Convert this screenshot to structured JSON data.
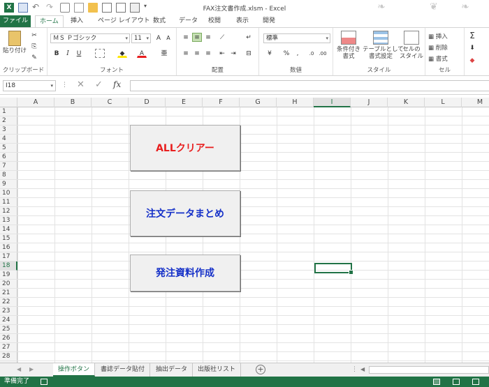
{
  "window": {
    "title": "FAX注文書作成.xlsm - Excel"
  },
  "ribbon_tabs": [
    "ファイル",
    "ホーム",
    "挿入",
    "ページ レイアウト",
    "数式",
    "データ",
    "校閲",
    "表示",
    "開発"
  ],
  "clipboard": {
    "paste_label": "貼り付け",
    "group_label": "クリップボード"
  },
  "font": {
    "name": "ＭＳ Ｐゴシック",
    "size": "11",
    "group_label": "フォント",
    "bold": "B",
    "italic": "I",
    "underline": "U"
  },
  "alignment": {
    "group_label": "配置"
  },
  "number": {
    "format": "標準",
    "group_label": "数値",
    "percent": "%",
    "comma": ","
  },
  "styles": {
    "conditional": "条件付き\n書式",
    "table": "テーブルとして\n書式設定",
    "cell_style": "セルの\nスタイル",
    "group_label": "スタイル"
  },
  "cells": {
    "insert": "挿入",
    "delete": "削除",
    "format": "書式",
    "group_label": "セル"
  },
  "formula_bar": {
    "name_box": "I18",
    "fx": "fx",
    "value": ""
  },
  "columns": [
    "A",
    "B",
    "C",
    "D",
    "E",
    "F",
    "G",
    "H",
    "I",
    "J",
    "K",
    "L",
    "M"
  ],
  "rows": [
    "1",
    "2",
    "3",
    "4",
    "5",
    "6",
    "7",
    "8",
    "9",
    "10",
    "11",
    "12",
    "13",
    "14",
    "15",
    "16",
    "17",
    "18",
    "19",
    "20",
    "21",
    "22",
    "23",
    "24",
    "25",
    "26",
    "27",
    "28"
  ],
  "selected": {
    "column": "I",
    "row": "18"
  },
  "buttons": [
    {
      "label": "ALLクリアー",
      "color": "#e81e1e"
    },
    {
      "label": "注文データまとめ",
      "color": "#1530c8"
    },
    {
      "label": "発注資料作成",
      "color": "#1530c8"
    }
  ],
  "sheet_tabs": [
    "操作ボタン",
    "書誌データ貼付",
    "抽出データ",
    "出版社リスト"
  ],
  "status": {
    "ready": "準備完了"
  },
  "colors": {
    "accent": "#217346"
  }
}
